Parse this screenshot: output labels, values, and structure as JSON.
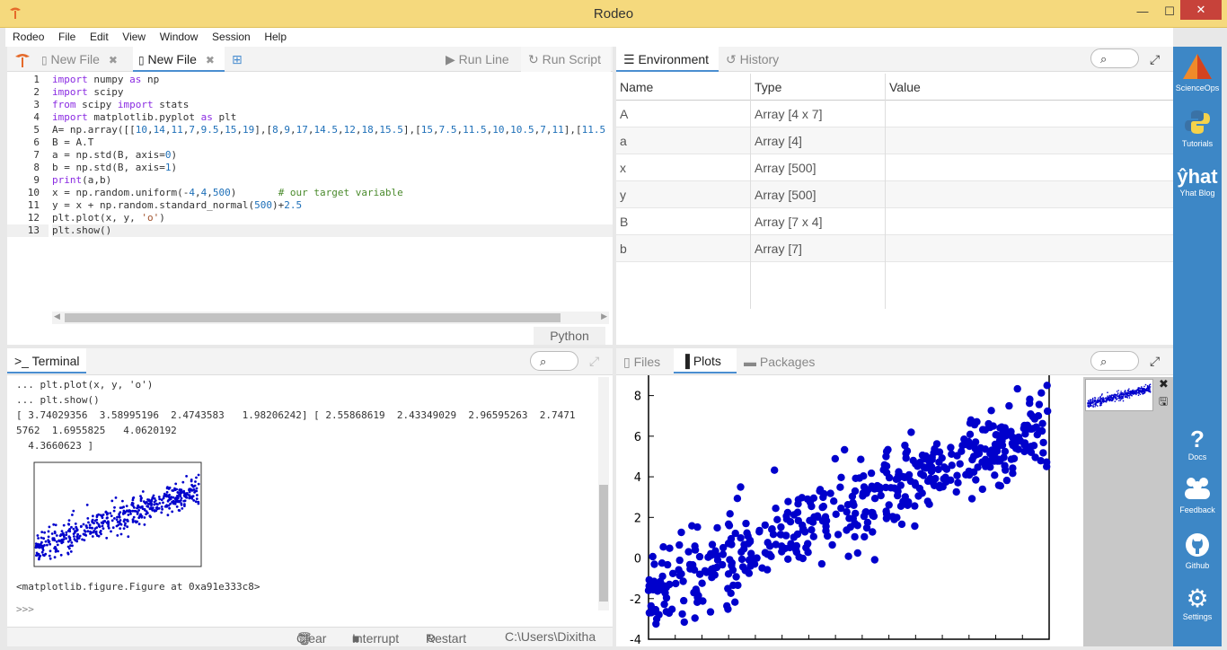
{
  "window": {
    "title": "Rodeo",
    "minimize": "—",
    "maximize": "☐",
    "close": "✕"
  },
  "menu": [
    "Rodeo",
    "File",
    "Edit",
    "View",
    "Window",
    "Session",
    "Help"
  ],
  "editor": {
    "tabs": [
      {
        "label": "New File",
        "active": false
      },
      {
        "label": "New File",
        "active": true
      }
    ],
    "run_line": "Run Line",
    "run_script": "Run Script",
    "language": "Python",
    "current_line": 13,
    "lines": [
      "import numpy as np",
      "import scipy",
      "from scipy import stats",
      "import matplotlib.pyplot as plt",
      "A= np.array([[10,14,11,7,9.5,15,19],[8,9,17,14.5,12,18,15.5],[15,7.5,11.5,10,10.5,7,11],[11.5",
      "B = A.T",
      "a = np.std(B, axis=0)",
      "b = np.std(B, axis=1)",
      "print(a,b)",
      "x = np.random.uniform(-4,4,500)       # our target variable",
      "y = x + np.random.standard_normal(500)+2.5",
      "plt.plot(x, y, 'o')",
      "plt.show()"
    ]
  },
  "environment": {
    "tabs": [
      "Environment",
      "History"
    ],
    "columns": [
      "Name",
      "Type",
      "Value"
    ],
    "rows": [
      {
        "name": "A",
        "type": "Array [4 x 7]",
        "value": ""
      },
      {
        "name": "a",
        "type": "Array [4]",
        "value": ""
      },
      {
        "name": "x",
        "type": "Array [500]",
        "value": ""
      },
      {
        "name": "y",
        "type": "Array [500]",
        "value": ""
      },
      {
        "name": "B",
        "type": "Array [7 x 4]",
        "value": ""
      },
      {
        "name": "b",
        "type": "Array [7]",
        "value": ""
      }
    ]
  },
  "terminal": {
    "tab": "Terminal",
    "lines": [
      "... plt.plot(x, y, 'o')",
      "... plt.show()",
      "[ 3.74029356  3.58995196  2.4743583   1.98206242] [ 2.55868619  2.43349029  2.96595263  2.7471",
      "5762  1.6955825   4.0620192",
      "  4.3660623 ]"
    ],
    "figure_repr": "<matplotlib.figure.Figure at 0xa91e333c8>",
    "prompt": ">>>",
    "footer": {
      "clear": "Clear",
      "interrupt": "Interrupt",
      "restart": "Restart",
      "cwd": "C:\\Users\\Dixitha"
    }
  },
  "plots": {
    "tabs": [
      "Files",
      "Plots",
      "Packages"
    ]
  },
  "sidebar": [
    {
      "label": "ScienceOps",
      "icon": "scienceops-icon"
    },
    {
      "label": "Tutorials",
      "icon": "python-icon"
    },
    {
      "label": "Yhat Blog",
      "icon": "yhat-icon"
    },
    {
      "label": "Docs",
      "icon": "question-icon"
    },
    {
      "label": "Feedback",
      "icon": "people-icon"
    },
    {
      "label": "Github",
      "icon": "github-icon"
    },
    {
      "label": "Settings",
      "icon": "gear-icon"
    }
  ],
  "chart_data": {
    "type": "scatter",
    "title": "",
    "xlabel": "",
    "ylabel": "",
    "xlim": [
      -4,
      4
    ],
    "ylim": [
      -4,
      9
    ],
    "yticks": [
      -4,
      -2,
      0,
      2,
      4,
      6,
      8
    ],
    "series": [
      {
        "color": "#0000cc",
        "model": "y = x + 2.5 + N(0,1)",
        "n": 500
      }
    ]
  },
  "colors": {
    "accent": "#4a8ed0",
    "sidebar": "#3d87c6",
    "titlebar": "#f5d97d",
    "points": "#0000cc"
  }
}
